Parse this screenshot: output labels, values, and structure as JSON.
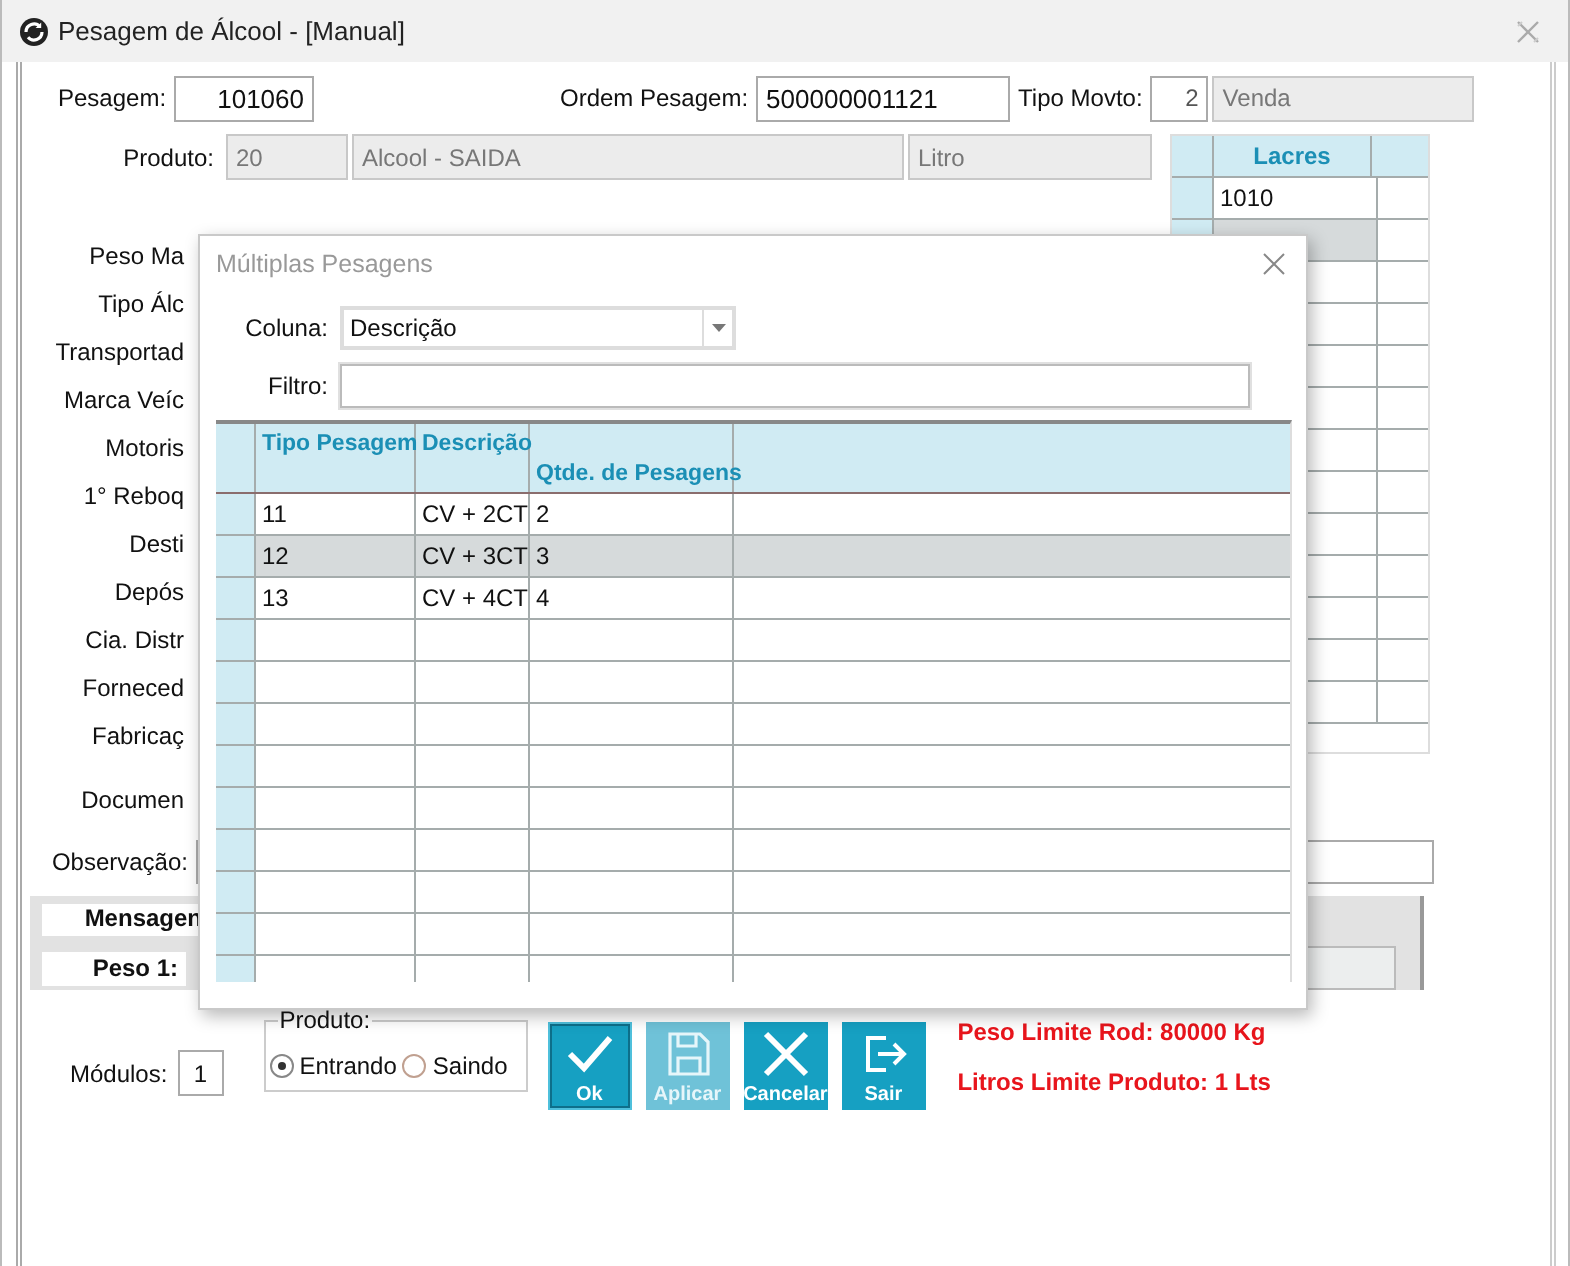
{
  "window": {
    "title": "Pesagem de Álcool - [Manual]"
  },
  "header": {
    "pesagem_label": "Pesagem:",
    "pesagem": "101060",
    "ordem_label": "Ordem Pesagem:",
    "ordem": "500000001121",
    "tipo_label": "Tipo Movto:",
    "tipo_code": "2",
    "tipo_name": "Venda"
  },
  "produto": {
    "label": "Produto:",
    "code": "20",
    "name": "Alcool - SAIDA",
    "unit": "Litro"
  },
  "side_labels": [
    "Peso Ma",
    "Tipo Álc",
    "Transportad",
    "Marca Veíc",
    "Motoris",
    "1° Reboq",
    "Desti",
    "Depós",
    "Cia. Distr",
    "Forneced",
    "Fabricaç",
    "Documen"
  ],
  "observacao": {
    "label": "Observação:"
  },
  "lacres": {
    "header": "Lacres",
    "rows": [
      {
        "value": "1010",
        "selected": false
      },
      {
        "selected": true
      }
    ]
  },
  "panel": {
    "title": "Mensagen",
    "peso_label": "Peso 1:"
  },
  "bottom": {
    "modulos_label": "Módulos:",
    "modulos": "1",
    "group_label": "Produto:",
    "radios": [
      {
        "label": "Entrando",
        "selected": true
      },
      {
        "label": "Saindo",
        "selected": false
      }
    ],
    "buttons": [
      {
        "label": "Ok",
        "selected": true,
        "disabled": false
      },
      {
        "label": "Aplicar",
        "selected": false,
        "disabled": true
      },
      {
        "label": "Cancelar",
        "selected": false,
        "disabled": false
      },
      {
        "label": "Sair",
        "selected": false,
        "disabled": false
      }
    ],
    "limits": [
      "Peso Limite Rod: 80000 Kg",
      "Litros Limite Produto: 1 Lts"
    ]
  },
  "dialog": {
    "title": "Múltiplas Pesagens",
    "coluna_label": "Coluna:",
    "coluna_value": "Descrição",
    "filtro_label": "Filtro:",
    "columns": [
      "Tipo Pesagem",
      "Descrição",
      "Qtde. de Pesagens"
    ],
    "rows": [
      {
        "cells": [
          "11",
          "CV + 2CT",
          "2"
        ],
        "selected": false
      },
      {
        "cells": [
          "12",
          "CV + 3CT",
          "3"
        ],
        "selected": true
      },
      {
        "cells": [
          "13",
          "CV + 4CT",
          "4"
        ],
        "selected": false
      }
    ]
  }
}
